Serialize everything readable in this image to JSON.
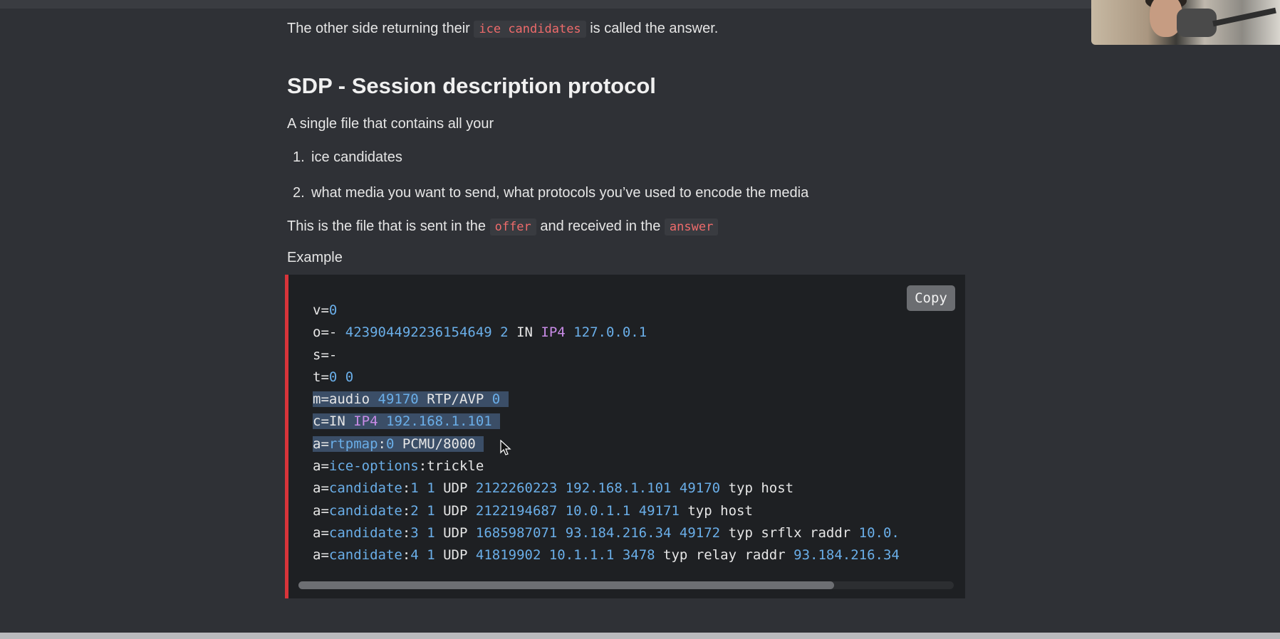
{
  "intro": {
    "before": "The other side returning their",
    "code": "ice candidates",
    "after": "is called the answer."
  },
  "heading": "SDP - Session description protocol",
  "description": "A single file that contains all your",
  "list": [
    {
      "num": "1.",
      "text": "ice candidates"
    },
    {
      "num": "2.",
      "text": "what media you want to send, what protocols you’ve used to encode the media"
    }
  ],
  "offer_sentence": {
    "before": "This is the file that is sent in the",
    "code1": "offer",
    "middle": "and received in the",
    "code2": "answer"
  },
  "example_label": "Example",
  "code_block": {
    "copy_label": "Copy",
    "lines": [
      "v=0",
      "o=- 423904492236154649 2 IN IP4 127.0.0.1",
      "s=-",
      "t=0 0",
      "m=audio 49170 RTP/AVP 0",
      "c=IN IP4 192.168.1.101",
      "a=rtpmap:0 PCMU/8000",
      "a=ice-options:trickle",
      "a=candidate:1 1 UDP 2122260223 192.168.1.101 49170 typ host",
      "a=candidate:2 1 UDP 2122194687 10.0.1.1 49171 typ host",
      "a=candidate:3 1 UDP 1685987071 93.184.216.34 49172 typ srflx raddr 10.0.",
      "a=candidate:4 1 UDP 41819902 10.1.1.1 3478 typ relay raddr 93.184.216.34"
    ],
    "selected_lines": [
      4,
      5,
      6
    ]
  },
  "colors": {
    "background": "#2f3136",
    "code_background": "#1e2023",
    "code_accent_border": "#d8343a",
    "inline_code_text": "#ef6b6b",
    "number_blue": "#6aaee8",
    "keyword_purple": "#c88be6"
  },
  "icons": {
    "cursor": "mouse-pointer-icon"
  }
}
